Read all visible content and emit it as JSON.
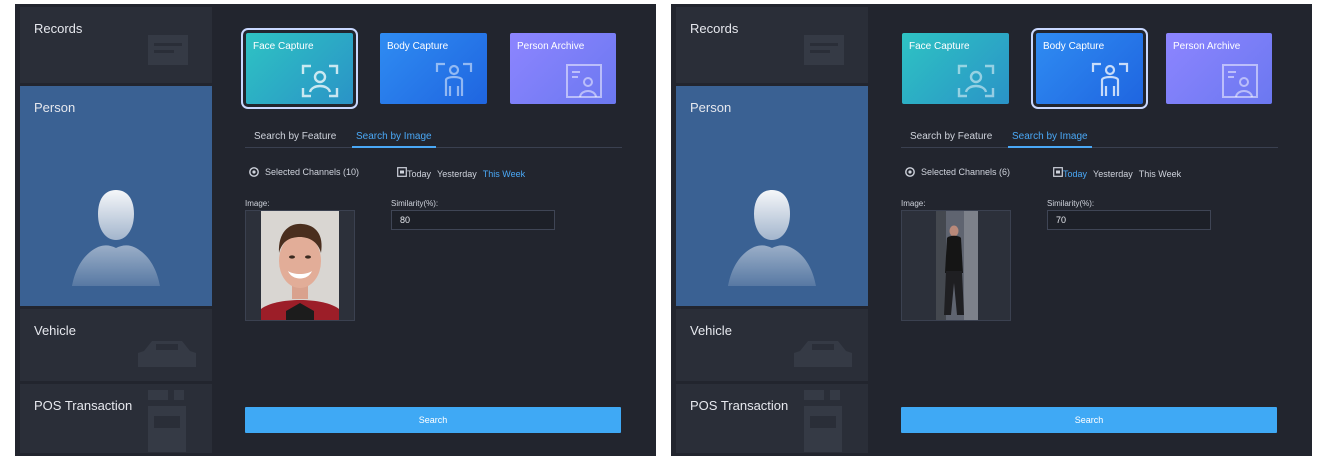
{
  "panels": [
    {
      "nav": {
        "records": "Records",
        "person": "Person",
        "vehicle": "Vehicle",
        "pos": "POS Transaction"
      },
      "capture": {
        "face": "Face Capture",
        "body": "Body Capture",
        "archive": "Person Archive",
        "selected": "face"
      },
      "tabs": {
        "feature": "Search by Feature",
        "image": "Search by Image",
        "active": "image"
      },
      "channels": "Selected Channels (10)",
      "dates": {
        "today": "Today",
        "yesterday": "Yesterday",
        "week": "This Week",
        "active": "week"
      },
      "image_label": "Image:",
      "image_icon": "face-portrait-photo",
      "similarity_label": "Similarity(%):",
      "similarity_value": "80",
      "search": "Search"
    },
    {
      "nav": {
        "records": "Records",
        "person": "Person",
        "vehicle": "Vehicle",
        "pos": "POS Transaction"
      },
      "capture": {
        "face": "Face Capture",
        "body": "Body Capture",
        "archive": "Person Archive",
        "selected": "body"
      },
      "tabs": {
        "feature": "Search by Feature",
        "image": "Search by Image",
        "active": "image"
      },
      "channels": "Selected Channels (6)",
      "dates": {
        "today": "Today",
        "yesterday": "Yesterday",
        "week": "This Week",
        "active": "today"
      },
      "image_label": "Image:",
      "image_icon": "full-body-photo",
      "similarity_label": "Similarity(%):",
      "similarity_value": "70",
      "search": "Search"
    }
  ],
  "colors": {
    "panel_bg": "#22252e",
    "nav_item": "#2a2e38",
    "nav_active": "#3a6193",
    "accent": "#4aa8f6",
    "button": "#3fa9f5"
  }
}
